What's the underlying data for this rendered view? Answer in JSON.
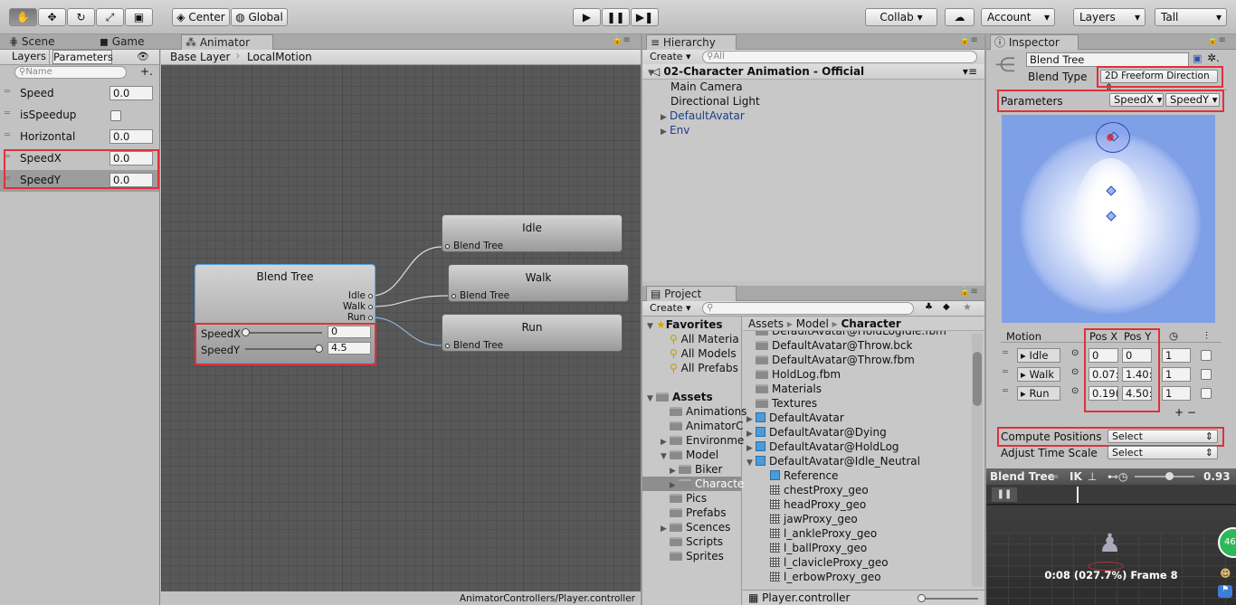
{
  "toolbar": {
    "pivot": "Center",
    "space": "Global",
    "collab": "Collab ▾",
    "account": "Account",
    "layers": "Layers",
    "layout": "Tall"
  },
  "scene_tabs": {
    "scene": "Scene",
    "game": "Game",
    "animator": "Animator"
  },
  "animator": {
    "subtabs": {
      "layers": "Layers",
      "parameters": "Parameters"
    },
    "search_placeholder": "Name",
    "breadcrumb": [
      "Base Layer",
      "LocalMotion"
    ],
    "parameters": [
      {
        "name": "Speed",
        "value": "0.0",
        "type": "float"
      },
      {
        "name": "isSpeedup",
        "value": "",
        "type": "bool"
      },
      {
        "name": "Horizontal",
        "value": "0.0",
        "type": "float"
      },
      {
        "name": "SpeedX",
        "value": "0.0",
        "type": "float"
      },
      {
        "name": "SpeedY",
        "value": "0.0",
        "type": "float"
      }
    ],
    "blend_tree": {
      "title": "Blend Tree",
      "outputs": [
        "Idle",
        "Walk",
        "Run"
      ],
      "speedx_label": "SpeedX",
      "speedx_value": "0",
      "speedy_label": "SpeedY",
      "speedy_value": "4.5"
    },
    "states": [
      {
        "name": "Idle",
        "sub": "Blend Tree"
      },
      {
        "name": "Walk",
        "sub": "Blend Tree"
      },
      {
        "name": "Run",
        "sub": "Blend Tree"
      }
    ],
    "footer": "AnimatorControllers/Player.controller"
  },
  "hierarchy": {
    "title": "Hierarchy",
    "create": "Create ▾",
    "search_placeholder": "All",
    "scene": "02-Character Animation - Official",
    "items": [
      "Main Camera",
      "Directional Light",
      "DefaultAvatar",
      "Env"
    ]
  },
  "project": {
    "title": "Project",
    "create": "Create ▾",
    "favorites_label": "Favorites",
    "favorites": [
      "All Materia",
      "All Models",
      "All Prefabs"
    ],
    "assets_label": "Assets",
    "tree": [
      "Animations",
      "AnimatorC",
      "Environme",
      "Model",
      "Biker",
      "Characte",
      "Pics",
      "Prefabs",
      "Scences",
      "Scripts",
      "Sprites"
    ],
    "path": [
      "Assets",
      "Model",
      "Character"
    ],
    "files": [
      "DefaultAvatar@HoldLogIdle.fbm",
      "DefaultAvatar@Throw.bck",
      "DefaultAvatar@Throw.fbm",
      "HoldLog.fbm",
      "Materials",
      "Textures",
      "DefaultAvatar",
      "DefaultAvatar@Dying",
      "DefaultAvatar@HoldLog",
      "DefaultAvatar@Idle_Neutral",
      "Reference",
      "chestProxy_geo",
      "headProxy_geo",
      "jawProxy_geo",
      "l_ankleProxy_geo",
      "l_ballProxy_geo",
      "l_clavicleProxy_geo",
      "l_erbowProxy_geo"
    ],
    "footer": "Player.controller"
  },
  "inspector": {
    "title": "Inspector",
    "name": "Blend Tree",
    "blend_type_label": "Blend Type",
    "blend_type": "2D Freeform Direction",
    "parameters_label": "Parameters",
    "param_x": "SpeedX",
    "param_y": "SpeedY",
    "table_headers": {
      "motion": "Motion",
      "pos_x": "Pos X",
      "pos_y": "Pos Y"
    },
    "motions": [
      {
        "name": "Idle",
        "pos_x": "0",
        "pos_y": "0",
        "speed": "1"
      },
      {
        "name": "Walk",
        "pos_x": "0.07:",
        "pos_y": "1.40:",
        "speed": "1"
      },
      {
        "name": "Run",
        "pos_x": "0.19(",
        "pos_y": "4.50:",
        "speed": "1"
      }
    ],
    "add_remove": "+ −",
    "compute_label": "Compute Positions",
    "compute_value": "Select",
    "adjust_label": "Adjust Time Scale",
    "adjust_value": "Select"
  },
  "preview": {
    "title": "Blend Tree",
    "ik": "IK",
    "speed": "0.93",
    "status": "0:08 (027.7%) Frame 8",
    "badge": "46"
  },
  "colors": {
    "highlight": "#e0303a",
    "plot_bg": "#7fa0e6",
    "grid_bg": "#585858"
  }
}
